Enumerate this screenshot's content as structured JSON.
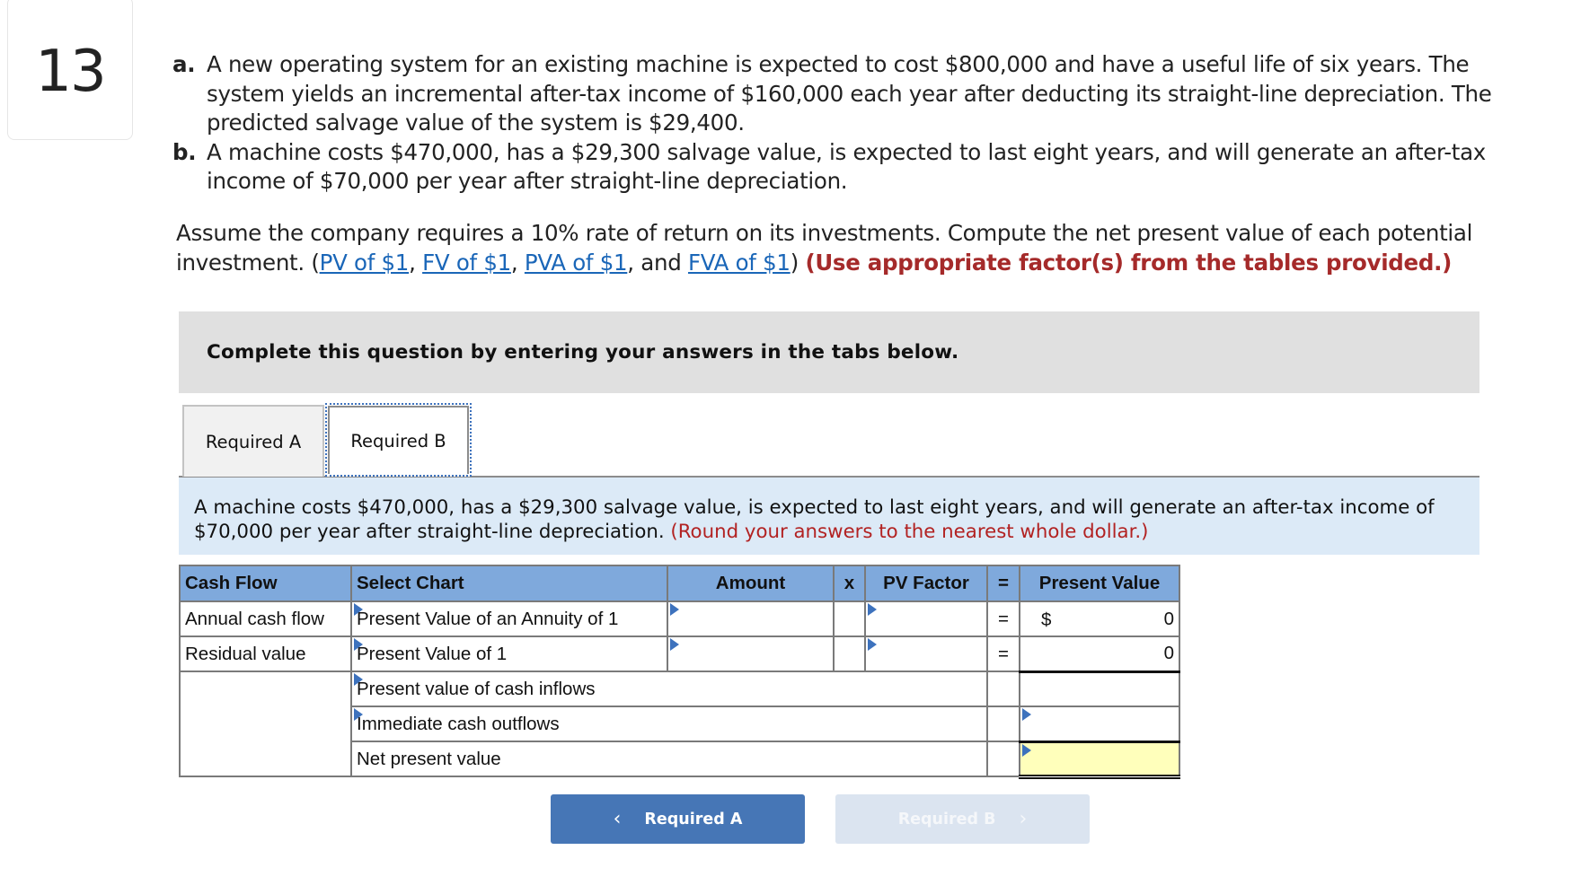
{
  "question_number": "13",
  "problem": {
    "parts": [
      {
        "letter": "a.",
        "text": "A new operating system for an existing machine is expected to cost $800,000 and have a useful life of six years. The system yields an incremental after-tax income of $160,000 each year after deducting its straight-line depreciation. The predicted salvage value of the system is $29,400."
      },
      {
        "letter": "b.",
        "text": "A machine costs $470,000, has a $29,300 salvage value, is expected to last eight years, and will generate an after-tax income of $70,000 per year after straight-line depreciation."
      }
    ]
  },
  "instruction": {
    "text_before": "Assume the company requires a 10% rate of return on its investments. Compute the net present value of each potential investment. (",
    "links": [
      "PV of $1",
      "FV of $1",
      "PVA of $1",
      "FVA of $1"
    ],
    "sep1": ", ",
    "sep2": ", ",
    "sep3": ", and ",
    "close": ") ",
    "emphasis": "(Use appropriate factor(s) from the tables provided.)"
  },
  "banner": "Complete this question by entering your answers in the tabs below.",
  "tabs": [
    {
      "label": "Required A",
      "active": false
    },
    {
      "label": "Required B",
      "active": true
    }
  ],
  "info": {
    "text": "A machine costs $470,000, has a $29,300 salvage value, is expected to last eight years, and will generate an after-tax income of $70,000 per year after straight-line depreciation. ",
    "note": "(Round your answers to the nearest whole dollar.)"
  },
  "table": {
    "headers": [
      "Cash Flow",
      "Select Chart",
      "Amount",
      "x",
      "PV Factor",
      "=",
      "Present Value"
    ],
    "rows": [
      {
        "cash_flow": "Annual cash flow",
        "chart": "Present Value of an Annuity of 1",
        "amount": "",
        "x": "",
        "pv_factor": "",
        "eq": "=",
        "currency": "$",
        "present_value": "0"
      },
      {
        "cash_flow": "Residual value",
        "chart": "Present Value of 1",
        "amount": "",
        "x": "",
        "pv_factor": "",
        "eq": "=",
        "currency": "",
        "present_value": "0"
      }
    ],
    "summary": [
      {
        "label": "Present value of cash inflows",
        "value": ""
      },
      {
        "label": "Immediate cash outflows",
        "value": ""
      },
      {
        "label": "Net present value",
        "value": ""
      }
    ]
  },
  "nav": {
    "prev_label": "Required A",
    "next_label": "Required B",
    "prev_chevron": "‹",
    "next_chevron": "›"
  },
  "colors": {
    "header_blue": "#7fa9dc",
    "button_blue": "#4676b6",
    "button_disabled": "#dbe4f0",
    "info_bg": "#dceaf7",
    "banner_bg": "#e0e0e0",
    "emphasis_red": "#a52a2a",
    "link_blue": "#1a66b8",
    "npv_highlight": "#ffffbb"
  }
}
